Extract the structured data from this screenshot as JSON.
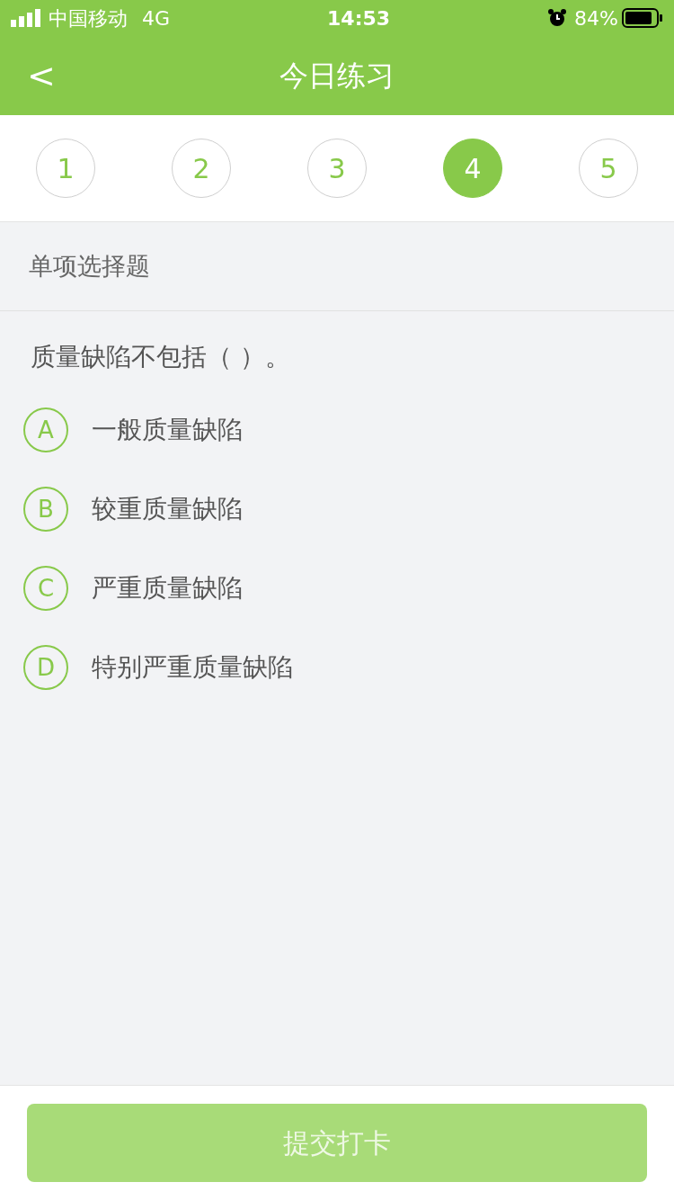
{
  "status_bar": {
    "carrier": "中国移动",
    "network": "4G",
    "time": "14:53",
    "battery": "84%"
  },
  "nav": {
    "back": "<",
    "title": "今日练习"
  },
  "question_numbers": [
    {
      "label": "1",
      "selected": false
    },
    {
      "label": "2",
      "selected": false
    },
    {
      "label": "3",
      "selected": false
    },
    {
      "label": "4",
      "selected": true
    },
    {
      "label": "5",
      "selected": false
    }
  ],
  "section": "单项选择题",
  "question": "质量缺陷不包括（   ）。",
  "options": [
    {
      "letter": "A",
      "text": "一般质量缺陷",
      "selected": false
    },
    {
      "letter": "B",
      "text": "较重质量缺陷",
      "selected": false
    },
    {
      "letter": "C",
      "text": "严重质量缺陷",
      "selected": false
    },
    {
      "letter": "D",
      "text": "特别严重质量缺陷",
      "selected": false
    }
  ],
  "submit": {
    "label": "提交打卡",
    "disabled": true
  }
}
